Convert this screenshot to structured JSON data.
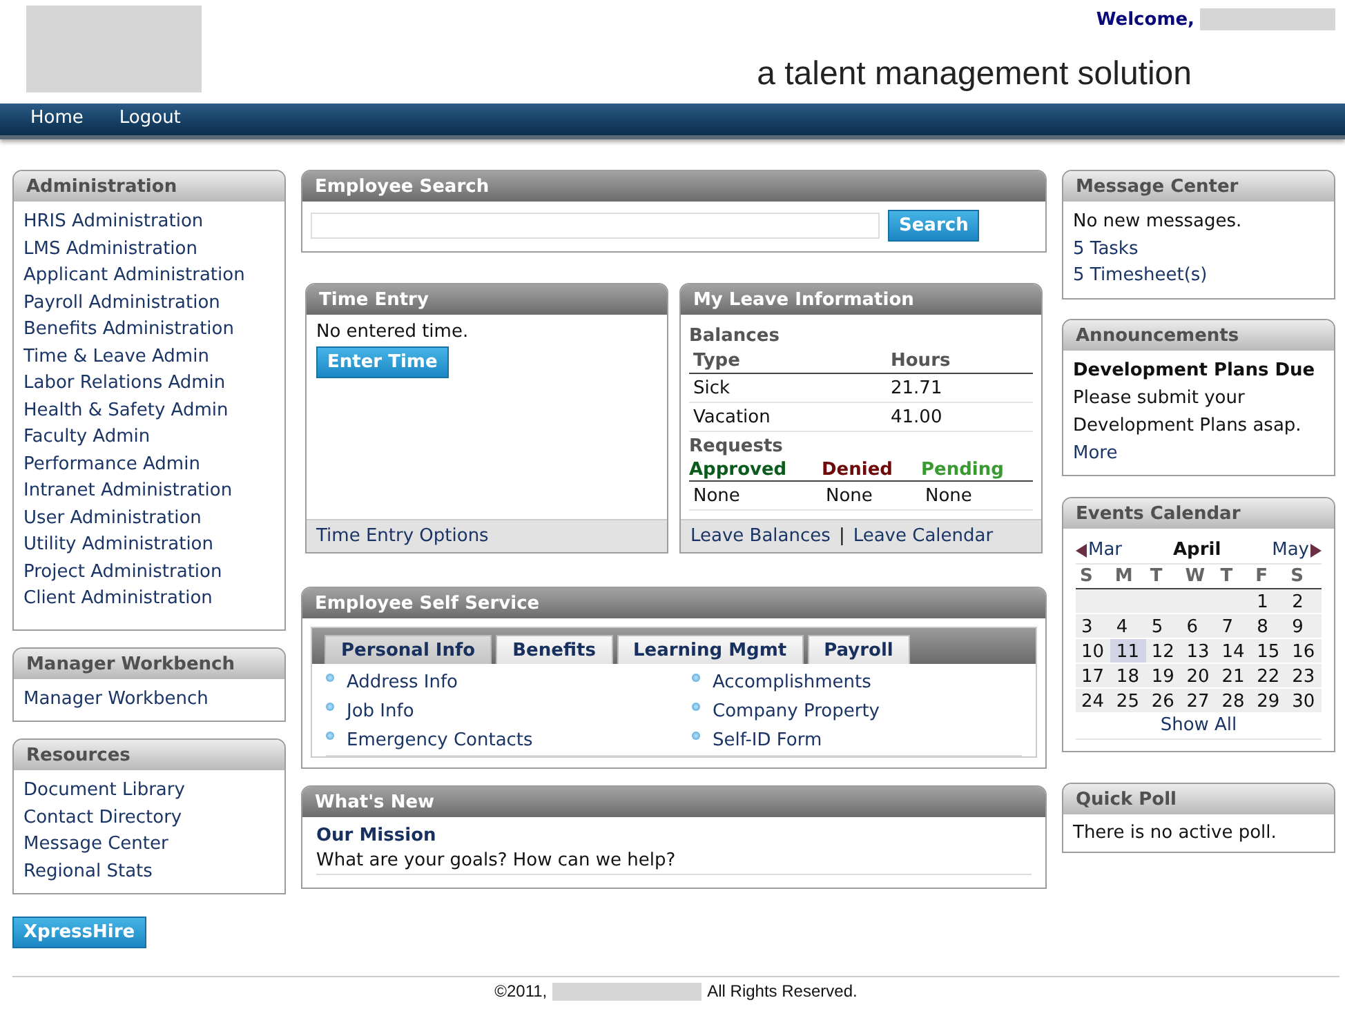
{
  "header": {
    "welcome": "Welcome,",
    "tagline": "a talent management solution"
  },
  "nav": [
    "Home",
    "Logout"
  ],
  "administration": {
    "title": "Administration",
    "links": [
      "HRIS Administration",
      "LMS Administration",
      "Applicant Administration",
      "Payroll Administration",
      "Benefits Administration",
      "Time & Leave Admin",
      "Labor Relations Admin",
      "Health & Safety Admin",
      "Faculty Admin",
      "Performance Admin",
      "Intranet Administration",
      "User Administration",
      "Utility Administration",
      "Project Administration",
      "Client Administration"
    ]
  },
  "manager_workbench": {
    "title": "Manager Workbench",
    "links": [
      "Manager Workbench"
    ]
  },
  "resources": {
    "title": "Resources",
    "links": [
      "Document Library",
      "Contact Directory",
      "Message Center",
      "Regional Stats"
    ]
  },
  "xpresshire_button": "XpressHire",
  "employee_search": {
    "title": "Employee Search",
    "button": "Search"
  },
  "time_entry": {
    "title": "Time Entry",
    "message": "No entered time.",
    "button": "Enter Time",
    "footer_link": "Time Entry Options"
  },
  "leave": {
    "title": "My Leave Information",
    "balances_heading": "Balances",
    "columns": [
      "Type",
      "Hours"
    ],
    "rows": [
      {
        "type": "Sick",
        "hours": "21.71"
      },
      {
        "type": "Vacation",
        "hours": "41.00"
      }
    ],
    "requests_heading": "Requests",
    "request_columns": [
      {
        "label": "Approved",
        "color": "#0b5c1c",
        "value": "None"
      },
      {
        "label": "Denied",
        "color": "#6e0a0a",
        "value": "None"
      },
      {
        "label": "Pending",
        "color": "#3a9a32",
        "value": "None"
      }
    ],
    "footer_links": [
      "Leave Balances",
      "Leave Calendar"
    ],
    "footer_separator": "|"
  },
  "self_service": {
    "title": "Employee Self Service",
    "tabs": [
      {
        "label": "Personal Info",
        "selected": true
      },
      {
        "label": "Benefits",
        "selected": false
      },
      {
        "label": "Learning Mgmt",
        "selected": false
      },
      {
        "label": "Payroll",
        "selected": false
      }
    ],
    "link_columns": [
      [
        "Address Info",
        "Job Info",
        "Emergency Contacts"
      ],
      [
        "Accomplishments",
        "Company Property",
        "Self-ID Form"
      ]
    ]
  },
  "whats_new": {
    "title": "What's New",
    "heading": "Our Mission",
    "text": "What are your goals? How can we help?"
  },
  "message_center": {
    "title": "Message Center",
    "message": "No new messages.",
    "links": [
      "5 Tasks",
      "5 Timesheet(s)"
    ]
  },
  "announcements": {
    "title": "Announcements",
    "heading": "Development Plans Due",
    "text": "Please submit your Development Plans asap.",
    "link": "More"
  },
  "events_calendar": {
    "title": "Events Calendar",
    "prev": "Mar",
    "month": "April",
    "next": "May",
    "weekdays": [
      "S",
      "M",
      "T",
      "W",
      "T",
      "F",
      "S"
    ],
    "weeks": [
      [
        {
          "kind": "blank"
        },
        {
          "kind": "blank"
        },
        {
          "kind": "blank"
        },
        {
          "kind": "blank"
        },
        {
          "kind": "blank"
        },
        {
          "kind": "day",
          "day": "1",
          "selected": false
        },
        {
          "kind": "day",
          "day": "2",
          "selected": false
        }
      ],
      [
        {
          "kind": "day",
          "day": "3",
          "selected": false
        },
        {
          "kind": "day",
          "day": "4",
          "selected": false
        },
        {
          "kind": "day",
          "day": "5",
          "selected": false
        },
        {
          "kind": "day",
          "day": "6",
          "selected": false
        },
        {
          "kind": "day",
          "day": "7",
          "selected": false
        },
        {
          "kind": "day",
          "day": "8",
          "selected": false
        },
        {
          "kind": "day",
          "day": "9",
          "selected": false
        }
      ],
      [
        {
          "kind": "day",
          "day": "10",
          "selected": false
        },
        {
          "kind": "day",
          "day": "11",
          "selected": true
        },
        {
          "kind": "day",
          "day": "12",
          "selected": false
        },
        {
          "kind": "day",
          "day": "13",
          "selected": false
        },
        {
          "kind": "day",
          "day": "14",
          "selected": false
        },
        {
          "kind": "day",
          "day": "15",
          "selected": false
        },
        {
          "kind": "day",
          "day": "16",
          "selected": false
        }
      ],
      [
        {
          "kind": "day",
          "day": "17",
          "selected": false
        },
        {
          "kind": "day",
          "day": "18",
          "selected": false
        },
        {
          "kind": "day",
          "day": "19",
          "selected": false
        },
        {
          "kind": "day",
          "day": "20",
          "selected": false
        },
        {
          "kind": "day",
          "day": "21",
          "selected": false
        },
        {
          "kind": "day",
          "day": "22",
          "selected": false
        },
        {
          "kind": "day",
          "day": "23",
          "selected": false
        }
      ],
      [
        {
          "kind": "day",
          "day": "24",
          "selected": false
        },
        {
          "kind": "day",
          "day": "25",
          "selected": false
        },
        {
          "kind": "day",
          "day": "26",
          "selected": false
        },
        {
          "kind": "day",
          "day": "27",
          "selected": false
        },
        {
          "kind": "day",
          "day": "28",
          "selected": false
        },
        {
          "kind": "day",
          "day": "29",
          "selected": false
        },
        {
          "kind": "day",
          "day": "30",
          "selected": false
        }
      ]
    ],
    "show_all": "Show All"
  },
  "quick_poll": {
    "title": "Quick Poll",
    "message": "There is no active poll."
  },
  "footer": {
    "prefix": "©2011,",
    "suffix": "All Rights Reserved."
  }
}
